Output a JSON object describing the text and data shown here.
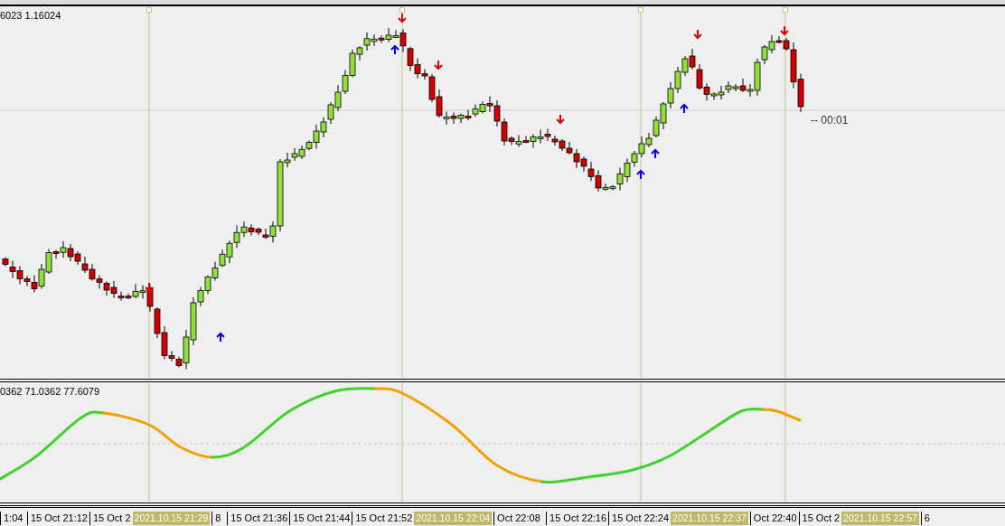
{
  "main_chart": {
    "label": "6023 1.16024",
    "countdown": "-- 00:01"
  },
  "indicator": {
    "label": "0362 71.0362 77.6079"
  },
  "time_axis": [
    {
      "kind": "tick",
      "text": "1:04"
    },
    {
      "kind": "tick",
      "text": "15 Oct 21:12"
    },
    {
      "kind": "tick",
      "text": "15 Oct 2"
    },
    {
      "kind": "highlight",
      "text": "2021.10.15 21:29"
    },
    {
      "kind": "tick",
      "text": "8"
    },
    {
      "kind": "tick",
      "text": "15 Oct 21:36"
    },
    {
      "kind": "tick",
      "text": "15 Oct 21:44"
    },
    {
      "kind": "tick",
      "text": "15 Oct 21:52"
    },
    {
      "kind": "highlight",
      "text": "2021.10.15 22:04"
    },
    {
      "kind": "tick",
      "text": "Oct 22:08"
    },
    {
      "kind": "tick",
      "text": "15 Oct 22:16"
    },
    {
      "kind": "tick",
      "text": "15 Oct 22:24"
    },
    {
      "kind": "highlight",
      "text": "2021.10.15 22:37"
    },
    {
      "kind": "tick",
      "text": "Oct 22:40"
    },
    {
      "kind": "tick",
      "text": "15 Oct 2"
    },
    {
      "kind": "highlight",
      "text": "2021.10.15 22:57"
    },
    {
      "kind": "tick",
      "text": "6"
    }
  ]
}
